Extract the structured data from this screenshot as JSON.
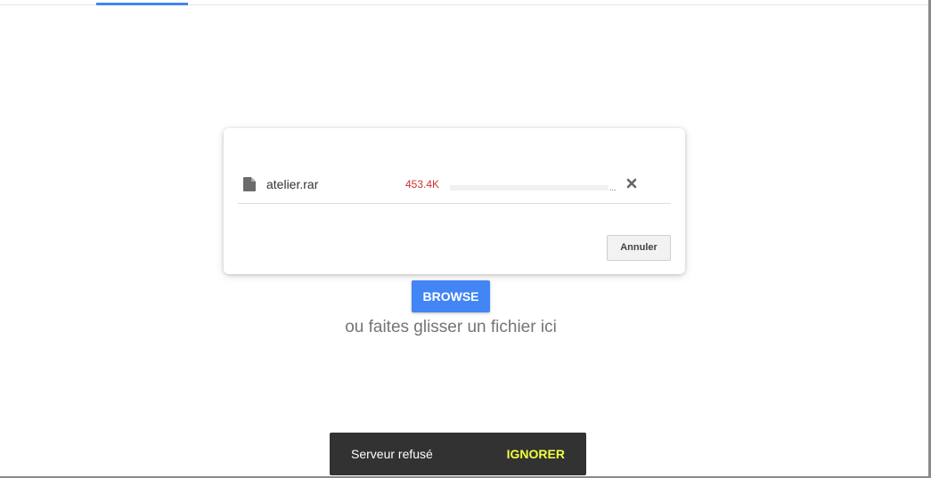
{
  "upload": {
    "file": {
      "name": "atelier.rar",
      "size": "453.4K",
      "progress_percent": 0,
      "progress_suffix": "...",
      "file_icon": "file-icon",
      "remove_icon": "close-icon"
    },
    "cancel_label": "Annuler"
  },
  "browse": {
    "label": "BROWSE",
    "drop_hint": "ou faites glisser un fichier ici"
  },
  "snackbar": {
    "message": "Serveur refusé",
    "action_label": "IGNORER"
  },
  "colors": {
    "accent": "#4285f4",
    "error": "#d32f2f",
    "snackbar_bg": "#323232",
    "snackbar_action": "#eeff41"
  }
}
